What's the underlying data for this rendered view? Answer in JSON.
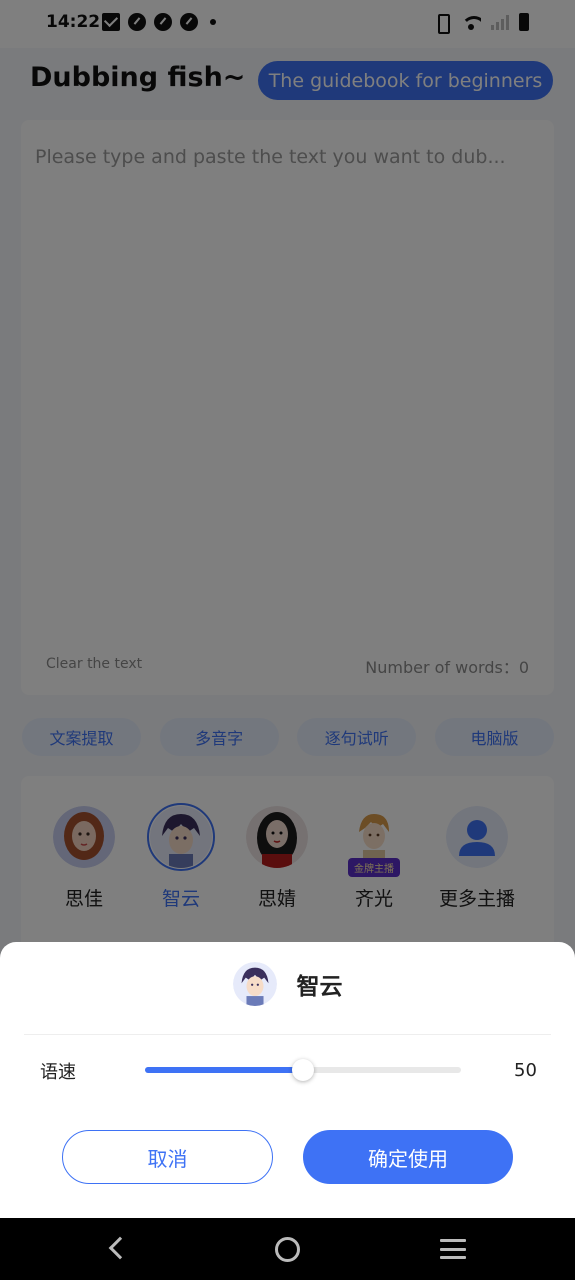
{
  "status_bar": {
    "time": "14:22"
  },
  "header": {
    "title": "Dubbing fish~",
    "guide_button": "The guidebook for beginners"
  },
  "editor": {
    "placeholder": "Please type and paste the text you want to dub...",
    "clear_label": "Clear the text",
    "word_count": "Number of words：0"
  },
  "tools": [
    {
      "label": "文案提取"
    },
    {
      "label": "多音字"
    },
    {
      "label": "逐句试听"
    },
    {
      "label": "电脑版"
    }
  ],
  "voices": [
    {
      "name": "思佳"
    },
    {
      "name": "智云"
    },
    {
      "name": "思婧"
    },
    {
      "name": "齐光",
      "badge": "金牌主播"
    },
    {
      "name": "更多主播"
    }
  ],
  "sheet": {
    "voice_name": "智云",
    "speed_label": "语速",
    "speed_value": "50",
    "speed_fraction": 0.5,
    "cancel_label": "取消",
    "confirm_label": "确定使用"
  },
  "colors": {
    "accent": "#3e72f5",
    "badge": "#5b2fc9"
  }
}
